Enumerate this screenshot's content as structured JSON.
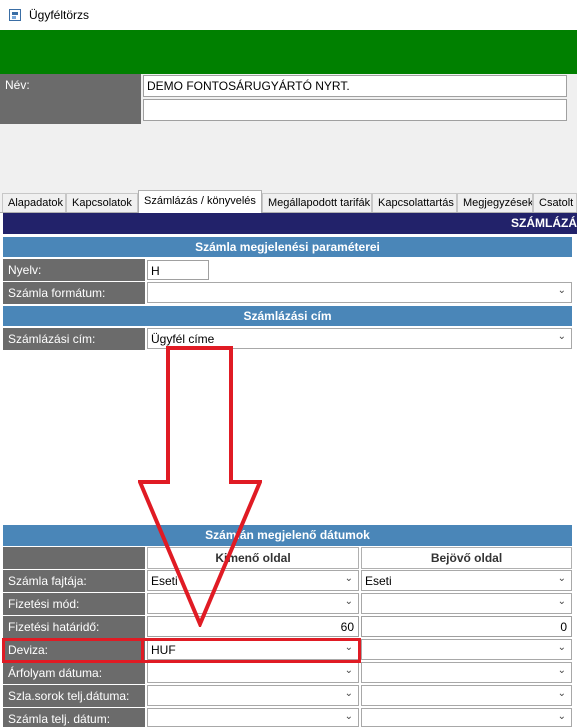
{
  "window": {
    "title": "Ügyféltörzs",
    "icon": "app-form-icon"
  },
  "header": {
    "name_label": "Név:",
    "name_value": "DEMO FONTOSÁRUGYÁRTÓ NYRT.",
    "name_value2": ""
  },
  "tabs": [
    {
      "label": "Alapadatok"
    },
    {
      "label": "Kapcsolatok"
    },
    {
      "label": "Számlázás / könyvelés"
    },
    {
      "label": "Megállapodott tarifák"
    },
    {
      "label": "Kapcsolattartás"
    },
    {
      "label": "Megjegyzések"
    },
    {
      "label": "Csatolt"
    }
  ],
  "active_tab": "Számlázás / könyvelés",
  "banner": "SZÁMLÁZÁ",
  "sections": {
    "params_title": "Számla megjelenési paraméterei",
    "address_title": "Számlázási cím",
    "dates_title": "Számlán megjelenő dátumok"
  },
  "params": {
    "language_label": "Nyelv:",
    "language_value": "H",
    "format_label": "Számla formátum:",
    "format_value": ""
  },
  "address": {
    "label": "Számlázási cím:",
    "value": "Ügyfél címe"
  },
  "grid": {
    "col_out": "Kimenő oldal",
    "col_in": "Bejövő oldal",
    "rows": [
      {
        "label": "Számla fajtája:",
        "out": "Eseti",
        "in": "Eseti"
      },
      {
        "label": "Fizetési mód:",
        "out": "",
        "in": ""
      },
      {
        "label": "Fizetési határidő:",
        "out": "60",
        "in": "0"
      },
      {
        "label": "Deviza:",
        "out": "HUF",
        "in": ""
      },
      {
        "label": "Árfolyam dátuma:",
        "out": "",
        "in": ""
      },
      {
        "label": "Szla.sorok telj.dátuma:",
        "out": "",
        "in": ""
      },
      {
        "label": "Számla telj. dátum:",
        "out": "",
        "in": ""
      }
    ]
  },
  "colors": {
    "green": "#008000",
    "navy": "#22226a",
    "section": "#4a86b8",
    "label": "#6b6b6b",
    "highlight": "#e01b24"
  }
}
